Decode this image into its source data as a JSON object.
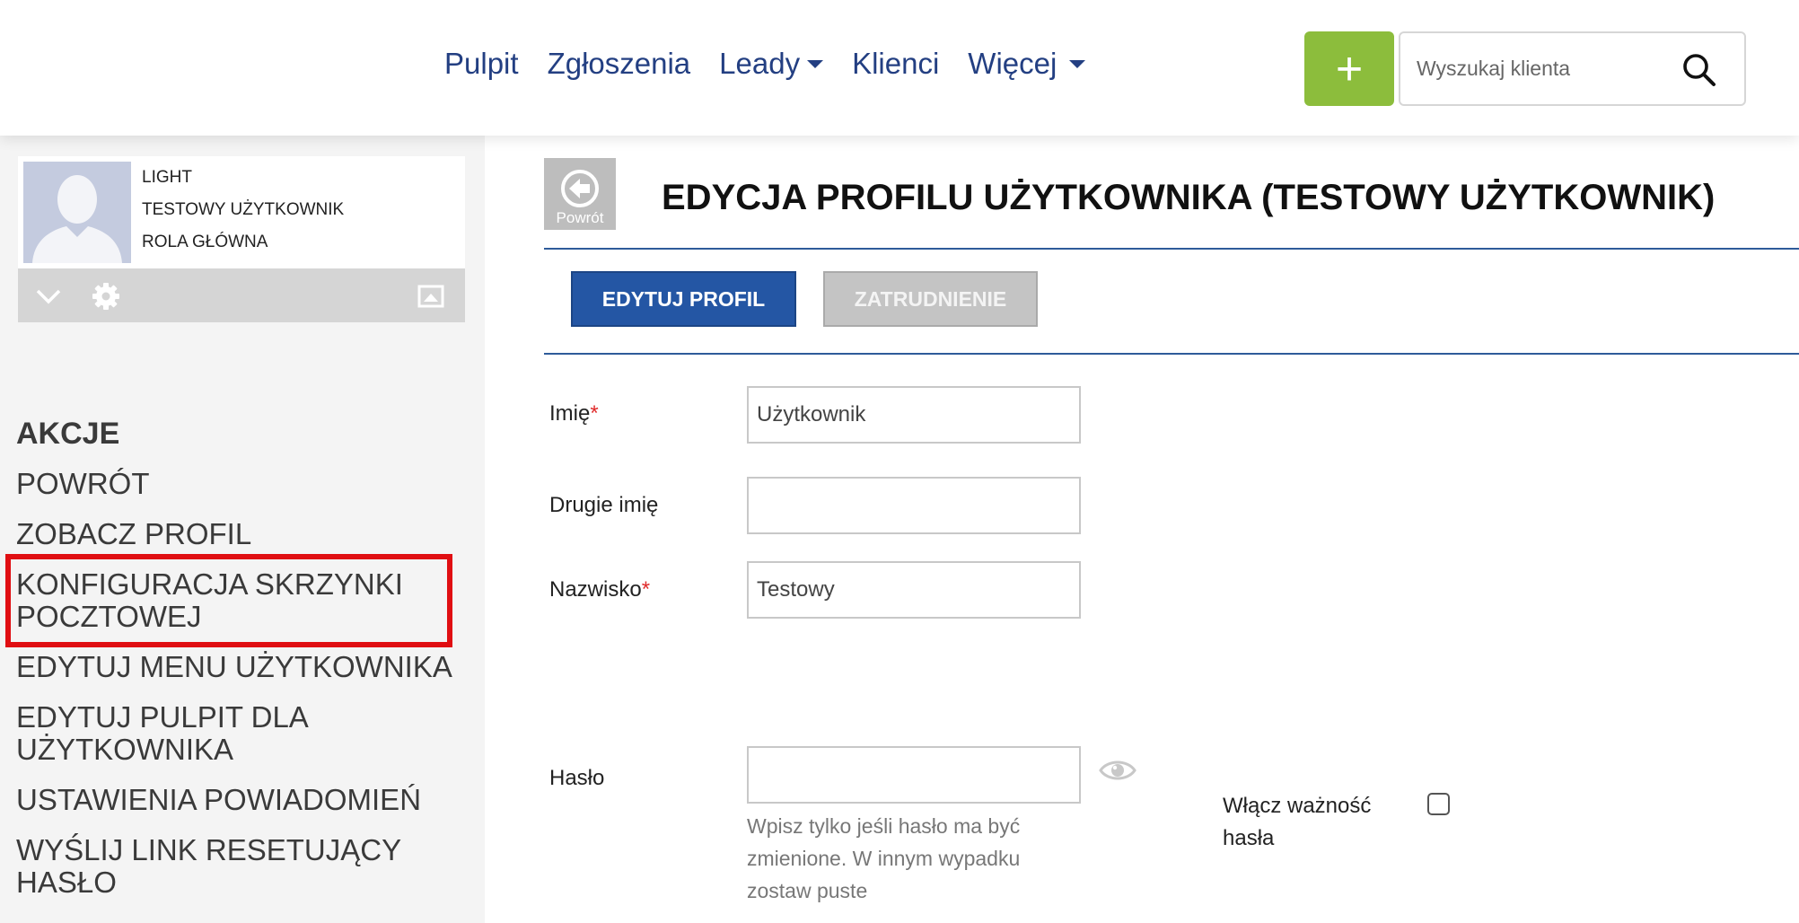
{
  "nav": {
    "items": [
      {
        "label": "Pulpit",
        "dropdown": false
      },
      {
        "label": "Zgłoszenia",
        "dropdown": false
      },
      {
        "label": "Leady",
        "dropdown": true
      },
      {
        "label": "Klienci",
        "dropdown": false
      },
      {
        "label": "Więcej",
        "dropdown": true
      }
    ],
    "add_label": "+",
    "search_placeholder": "Wyszukaj klienta"
  },
  "profile": {
    "plan": "LIGHT",
    "user_name": "TESTOWY UŻYTKOWNIK",
    "role": "ROLA GŁÓWNA"
  },
  "sidebar": {
    "actions_title": "AKCJE",
    "actions": [
      "POWRÓT",
      "ZOBACZ PROFIL",
      "KONFIGURACJA SKRZYNKI POCZTOWEJ",
      "EDYTUJ MENU UŻYTKOWNIKA",
      "EDYTUJ PULPIT DLA UŻYTKOWNIKA",
      "USTAWIENIA POWIADOMIEŃ",
      "WYŚLIJ LINK RESETUJĄCY HASŁO"
    ],
    "highlighted_action": "KONFIGURACJA SKRZYNKI POCZTOWEJ"
  },
  "main": {
    "back_label": "Powrót",
    "title": "EDYCJA PROFILU UŻYTKOWNIKA (TESTOWY UŻYTKOWNIK)",
    "tabs": [
      {
        "label": "EDYTUJ PROFIL",
        "active": true
      },
      {
        "label": "ZATRUDNIENIE",
        "active": false
      }
    ],
    "form": {
      "first_name": {
        "label": "Imię",
        "required": "*",
        "value": "Użytkownik"
      },
      "middle_name": {
        "label": "Drugie imię",
        "value": ""
      },
      "last_name": {
        "label": "Nazwisko",
        "required": "*",
        "value": "Testowy"
      },
      "password": {
        "label": "Hasło",
        "value": "",
        "hint": "Wpisz tylko jeśli hasło ma być zmienione. W innym wypadku zostaw puste"
      },
      "password_expiry": {
        "label": "Włącz ważność hasła",
        "checked": false
      }
    }
  },
  "colors": {
    "nav_text": "#233f82",
    "add_button": "#8cbd3c",
    "active_tab": "#2456a4",
    "highlight_outline": "#e00e12",
    "required_marker": "#e02a2a"
  },
  "icons": {
    "search": "search-icon",
    "back": "arrow-left-circle-icon",
    "collapse": "chevron-down-icon",
    "settings": "gear-icon",
    "image": "image-icon",
    "show_password": "eye-icon"
  }
}
